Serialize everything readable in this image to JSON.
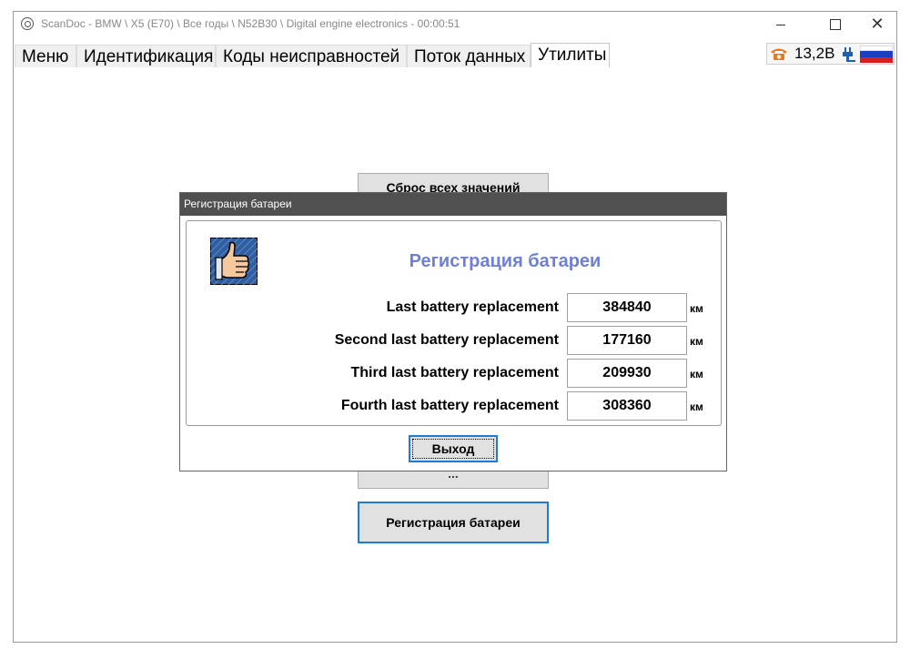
{
  "window": {
    "title": "ScanDoc - BMW \\ X5 (E70) \\ Все годы \\ N52B30 \\ Digital engine electronics - 00:00:51"
  },
  "tabs": [
    {
      "label": "Меню"
    },
    {
      "label": "Идентификация"
    },
    {
      "label": "Коды неисправностей"
    },
    {
      "label": "Поток данных"
    },
    {
      "label": "Утилиты"
    }
  ],
  "status": {
    "voltage": "13,2В",
    "phone_icon_color": "#e87a1a"
  },
  "background_buttons": {
    "reset_all": "Сброс всех значений",
    "partial": "...",
    "battery_registration": "Регистрация батареи"
  },
  "dialog": {
    "title": "Регистрация батареи",
    "heading": "Регистрация батареи",
    "heading_color": "#6f7fd6",
    "rows": [
      {
        "label": "Last battery replacement",
        "value": "384840",
        "unit": "км"
      },
      {
        "label": "Second last battery replacement",
        "value": "177160",
        "unit": "км"
      },
      {
        "label": "Third last battery replacement",
        "value": "209930",
        "unit": "км"
      },
      {
        "label": "Fourth last battery replacement",
        "value": "308360",
        "unit": "км"
      }
    ],
    "exit_label": "Выход"
  }
}
